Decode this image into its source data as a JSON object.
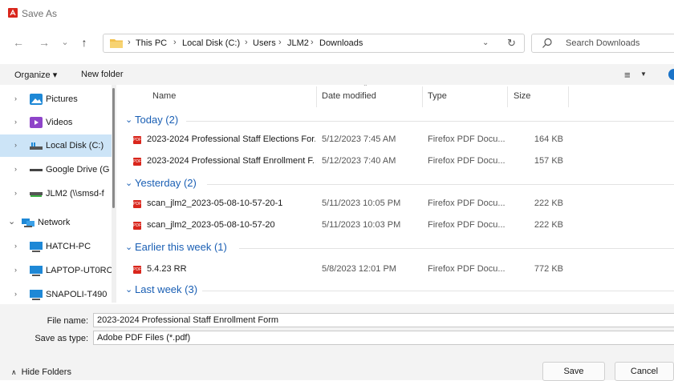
{
  "window": {
    "title": "Save As"
  },
  "nav": {
    "back": "←",
    "forward": "→",
    "recent": "⌄",
    "up": "↑",
    "breadcrumbs": [
      "This PC",
      "Local Disk (C:)",
      "Users",
      "JLM2",
      "Downloads"
    ],
    "separator": "›",
    "dropdown": "⌄",
    "refresh": "↻",
    "search_placeholder": "Search Downloads"
  },
  "toolbar": {
    "organize": "Organize ▾",
    "new_folder": "New folder",
    "view": "≡",
    "view_chevron": "▼"
  },
  "sidebar": {
    "items": [
      {
        "label": "Pictures",
        "icon": "pictures-icon",
        "chevron": "›"
      },
      {
        "label": "Videos",
        "icon": "videos-icon",
        "chevron": "›"
      },
      {
        "label": "Local Disk (C:)",
        "icon": "drive-icon",
        "chevron": "›"
      },
      {
        "label": "Google Drive (G",
        "icon": "drive-dash-icon",
        "chevron": "›"
      },
      {
        "label": "JLM2 (\\\\smsd-f",
        "icon": "network-drive-icon",
        "chevron": "›"
      },
      {
        "label": "Network",
        "icon": "network-icon",
        "chevron": "⌄"
      },
      {
        "label": "HATCH-PC",
        "icon": "computer-icon",
        "chevron": "›"
      },
      {
        "label": "LAPTOP-UT0RC",
        "icon": "computer-icon",
        "chevron": "›"
      },
      {
        "label": "SNAPOLI-T490",
        "icon": "computer-icon",
        "chevron": "›"
      }
    ]
  },
  "columns": {
    "name": "Name",
    "date": "Date modified",
    "type": "Type",
    "size": "Size",
    "sort_indicator": "⌃"
  },
  "groups": [
    {
      "label": "Today (2)",
      "files": [
        {
          "name": "2023-2024 Professional Staff Elections For...",
          "date": "5/12/2023 7:45 AM",
          "type": "Firefox PDF Docu...",
          "size": "164 KB"
        },
        {
          "name": "2023-2024 Professional Staff Enrollment F...",
          "date": "5/12/2023 7:40 AM",
          "type": "Firefox PDF Docu...",
          "size": "157 KB"
        }
      ]
    },
    {
      "label": "Yesterday (2)",
      "files": [
        {
          "name": "scan_jlm2_2023-05-08-10-57-20-1",
          "date": "5/11/2023 10:05 PM",
          "type": "Firefox PDF Docu...",
          "size": "222 KB"
        },
        {
          "name": "scan_jlm2_2023-05-08-10-57-20",
          "date": "5/11/2023 10:03 PM",
          "type": "Firefox PDF Docu...",
          "size": "222 KB"
        }
      ]
    },
    {
      "label": "Earlier this week (1)",
      "files": [
        {
          "name": "5.4.23 RR",
          "date": "5/8/2023 12:01 PM",
          "type": "Firefox PDF Docu...",
          "size": "772 KB"
        }
      ]
    },
    {
      "label": "Last week (3)",
      "files": []
    }
  ],
  "group_chevron": "⌄",
  "pdf_label": "PDF",
  "form": {
    "file_name_label": "File name:",
    "file_name_value": "2023-2024 Professional Staff Enrollment Form",
    "save_type_label": "Save as type:",
    "save_type_value": "Adobe PDF Files (*.pdf)"
  },
  "footer": {
    "hide_folders": "Hide Folders",
    "hide_arrow": "∧",
    "save": "Save",
    "cancel": "Cancel"
  },
  "colors": {
    "accent": "#1a5fb4",
    "selected": "#cce4f7",
    "pdf": "#d9261c"
  }
}
